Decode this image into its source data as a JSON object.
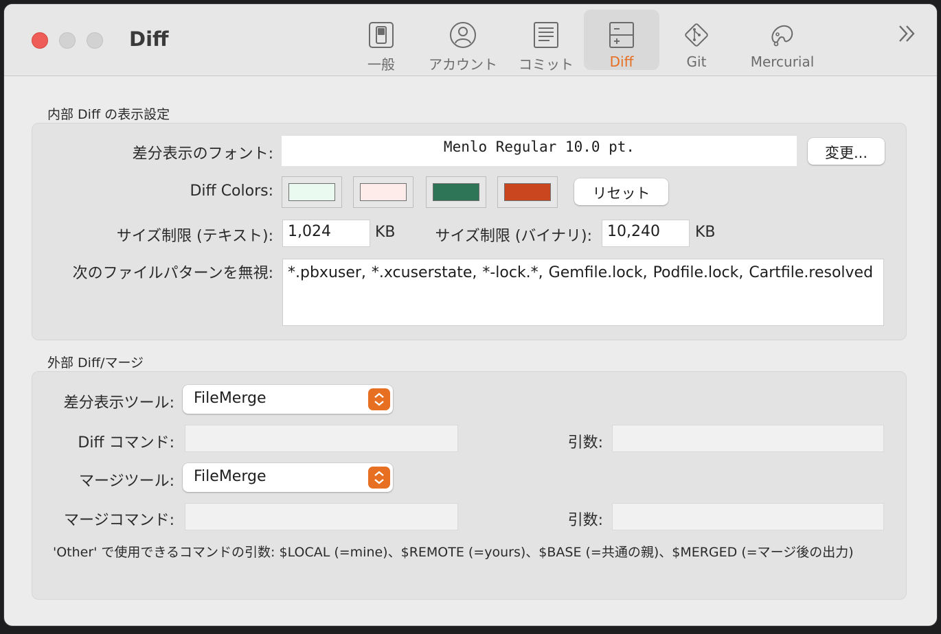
{
  "window": {
    "title": "Diff"
  },
  "toolbar": {
    "tabs": [
      {
        "label": "一般",
        "icon": "switch-icon"
      },
      {
        "label": "アカウント",
        "icon": "person-circle-icon"
      },
      {
        "label": "コミット",
        "icon": "text-document-icon"
      },
      {
        "label": "Diff",
        "icon": "plus-minus-icon",
        "selected": true
      },
      {
        "label": "Git",
        "icon": "git-diamond-icon"
      },
      {
        "label": "Mercurial",
        "icon": "mercurial-drop-icon"
      }
    ],
    "overflow_icon": "double-chevron-right-icon"
  },
  "internal": {
    "section_title": "内部 Diff の表示設定",
    "font_label": "差分表示のフォント:",
    "font_value": "Menlo Regular 10.0 pt.",
    "change_button": "変更...",
    "colors_label": "Diff Colors:",
    "colors": [
      "#eafaf1",
      "#fdecea",
      "#2e7558",
      "#c9461e"
    ],
    "reset_button": "リセット",
    "size_text_label": "サイズ制限 (テキスト):",
    "size_text_value": "1,024",
    "size_text_unit": "KB",
    "size_binary_label": "サイズ制限 (バイナリ):",
    "size_binary_value": "10,240",
    "size_binary_unit": "KB",
    "ignore_label": "次のファイルパターンを無視:",
    "ignore_value": "*.pbxuser, *.xcuserstate, *-lock.*, Gemfile.lock, Podfile.lock, Cartfile.resolved"
  },
  "external": {
    "section_title": "外部 Diff/マージ",
    "diff_tool_label": "差分表示ツール:",
    "diff_tool_value": "FileMerge",
    "diff_command_label": "Diff コマンド:",
    "diff_command_value": "",
    "diff_args_label": "引数:",
    "diff_args_value": "",
    "merge_tool_label": "マージツール:",
    "merge_tool_value": "FileMerge",
    "merge_command_label": "マージコマンド:",
    "merge_command_value": "",
    "merge_args_label": "引数:",
    "merge_args_value": "",
    "note": "'Other' で使用できるコマンドの引数: $LOCAL (=mine)、$REMOTE (=yours)、$BASE (=共通の親)、$MERGED (=マージ後の出力)"
  },
  "colors": {
    "accent": "#e66f22",
    "close": "#ee5d57"
  }
}
